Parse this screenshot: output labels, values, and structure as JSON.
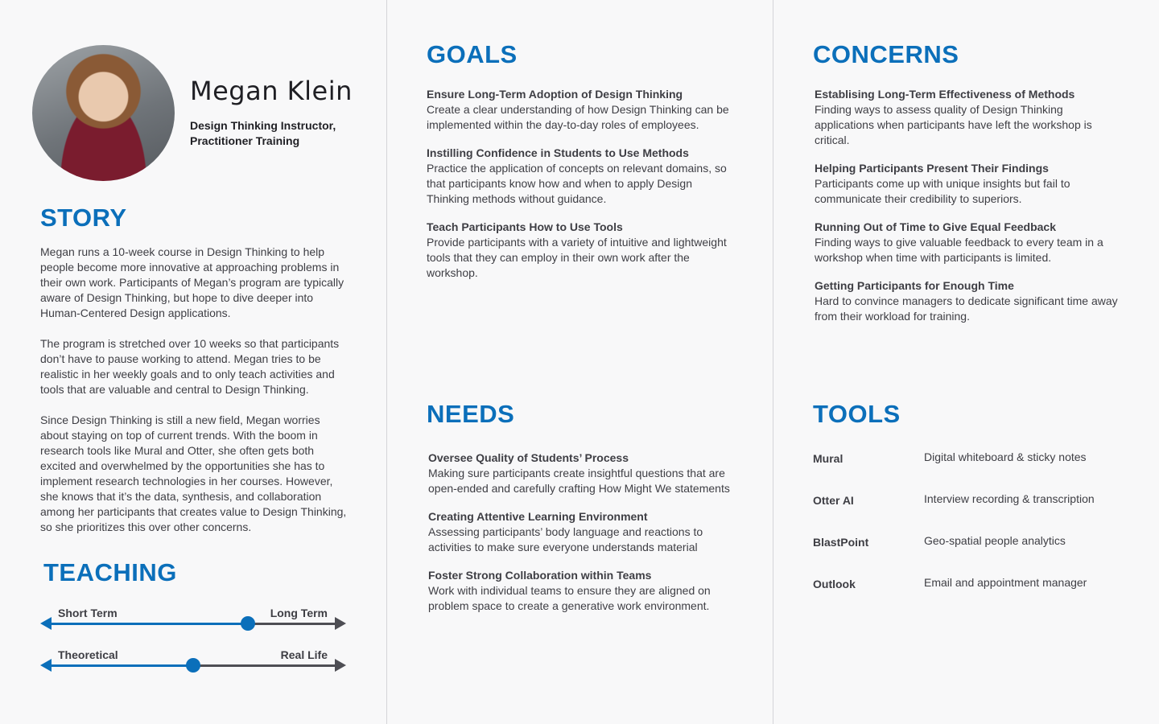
{
  "profile": {
    "name": "Megan Klein",
    "role": "Design Thinking Instructor, Practitioner Training"
  },
  "story": {
    "heading": "STORY",
    "paragraphs": [
      "Megan runs a 10-week course in Design Thinking to help people become more innovative at approaching problems in their own work. Participants of Megan’s program are typically aware of Design Thinking, but hope to dive deeper into Human-Centered Design applications.",
      "The program is stretched over 10 weeks so that participants don’t have to pause working to attend. Megan tries to be realistic in her weekly goals and to only teach activities and tools that are valuable and central to Design Thinking.",
      "Since Design Thinking is still a new field, Megan worries about staying on top of current trends. With the boom in research tools like Mural and Otter, she often gets both excited and overwhelmed by the opportunities she has to implement research technologies in her courses. However, she knows that it’s the data, synthesis, and collaboration among her participants that creates value to Design Thinking, so she prioritizes this over other concerns."
    ]
  },
  "teaching": {
    "heading": "TEACHING",
    "scales": [
      {
        "left_label": "Short Term",
        "right_label": "Long Term",
        "position": 0.69
      },
      {
        "left_label": "Theoretical",
        "right_label": "Real Life",
        "position": 0.5
      }
    ]
  },
  "goals": {
    "heading": "GOALS",
    "items": [
      {
        "title": "Ensure Long-Term Adoption of Design Thinking",
        "desc": "Create a clear understanding of how Design Thinking can be implemented within the day-to-day roles of employees."
      },
      {
        "title": "Instilling Confidence in Students to Use Methods",
        "desc": "Practice the application of concepts on relevant domains, so that participants know how and when to apply Design Thinking methods without guidance."
      },
      {
        "title": "Teach Participants How to Use Tools",
        "desc": "Provide participants with a variety of intuitive and lightweight tools that they can employ in their own work after the workshop."
      }
    ]
  },
  "needs": {
    "heading": "NEEDS",
    "items": [
      {
        "title": "Oversee Quality of Students’ Process",
        "desc": "Making sure participants create insightful questions that are open-ended and carefully crafting How Might We statements"
      },
      {
        "title": "Creating Attentive Learning Environment",
        "desc": "Assessing participants’ body language and reactions to activities to make sure everyone understands material"
      },
      {
        "title": "Foster Strong Collaboration within Teams",
        "desc": "Work with individual teams to ensure they are aligned on problem space to create a generative work environment."
      }
    ]
  },
  "concerns": {
    "heading": "CONCERNS",
    "items": [
      {
        "title": "Establising Long-Term Effectiveness of Methods",
        "desc": "Finding ways to assess quality of Design Thinking applications when participants have left the workshop is critical."
      },
      {
        "title": "Helping Participants Present Their Findings",
        "desc": "Participants come up with unique insights but fail to communicate their credibility to superiors."
      },
      {
        "title": "Running Out of Time to Give Equal Feedback",
        "desc": "Finding ways to give valuable feedback to every team in a workshop when time with participants is limited."
      },
      {
        "title": "Getting Participants for Enough Time",
        "desc": "Hard to convince managers to dedicate significant time away from their workload for training."
      }
    ]
  },
  "tools": {
    "heading": "TOOLS",
    "items": [
      {
        "name": "Mural",
        "desc": "Digital whiteboard & sticky notes"
      },
      {
        "name": "Otter AI",
        "desc": "Interview recording & transcription"
      },
      {
        "name": "BlastPoint",
        "desc": "Geo-spatial people analytics"
      },
      {
        "name": "Outlook",
        "desc": "Email and appointment manager"
      }
    ]
  },
  "colors": {
    "accent": "#0b6fba",
    "text": "#3e3e44",
    "background": "#f8f8f9"
  }
}
